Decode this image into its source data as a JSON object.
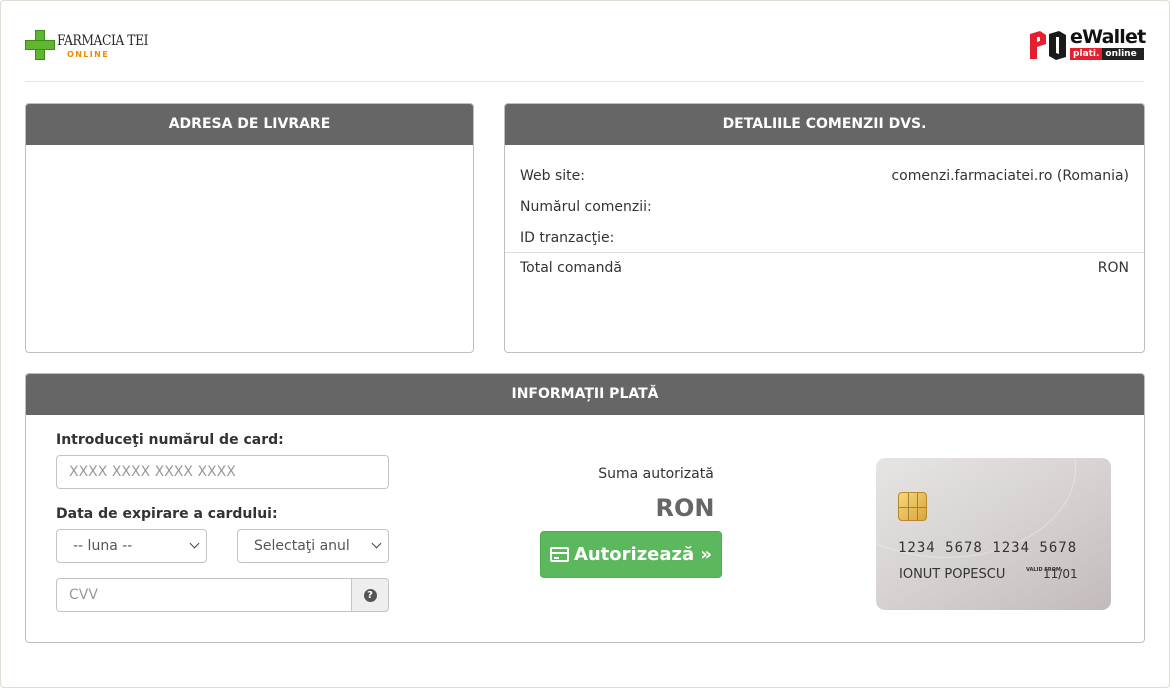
{
  "header": {
    "merchant_logo": {
      "name": "FARMACIA TEI",
      "sub": "ONLINE"
    },
    "provider_logo": {
      "title": "eWallet",
      "sub_left": "plati.",
      "sub_right": "online"
    }
  },
  "address_panel": {
    "title": "ADRESA DE LIVRARE"
  },
  "order_panel": {
    "title": "DETALIILE COMENZII DVS.",
    "rows": [
      {
        "label": "Web site:",
        "value": "comenzi.farmaciatei.ro (Romania)"
      },
      {
        "label": "Numărul comenzii:",
        "value": ""
      },
      {
        "label": "ID tranzacţie:",
        "value": ""
      }
    ],
    "total": {
      "label": "Total comandă",
      "value": "RON"
    }
  },
  "payment_panel": {
    "title": "INFORMAȚII PLATĂ",
    "card_number_label": "Introduceţi numărul de card:",
    "card_number_placeholder": "XXXX XXXX XXXX XXXX",
    "expiry_label": "Data de expirare a cardului:",
    "month_select": "-- luna --",
    "year_select": "Selectaţi anul",
    "cvv_placeholder": "CVV",
    "help_icon": "question-circle-icon",
    "amount_label": "Suma autorizată",
    "amount_value": "RON",
    "authorize_button": "Autorizează »",
    "card_preview": {
      "number": "1234 5678 1234 5678",
      "holder": "IONUT POPESCU",
      "valid_from_label": "VALID FROM",
      "expiry": "11/01"
    }
  },
  "colors": {
    "panel_header": "#666666",
    "button_green": "#5cb85c",
    "brand_green": "#5eb82f",
    "brand_orange": "#f08a00",
    "brand_red": "#e4202e"
  }
}
